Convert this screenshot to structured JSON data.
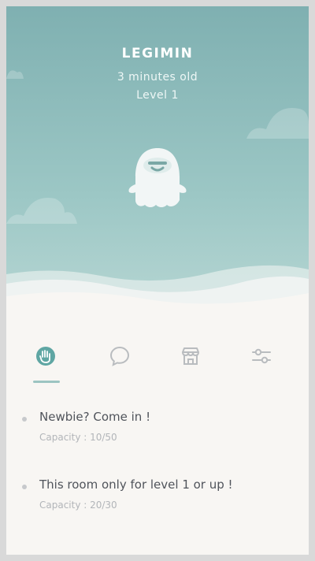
{
  "pet": {
    "name": "LEGIMIN",
    "age": "3 minutes old",
    "level": "Level 1"
  },
  "colors": {
    "sky_top": "#7fb0b1",
    "sky_bottom": "#b8d7d4",
    "accent": "#5fa6a3",
    "muted_icon": "#b9bcbf",
    "background": "#f8f6f3"
  },
  "tabs": [
    {
      "icon": "hand-icon",
      "active": true
    },
    {
      "icon": "chat-bubble-icon",
      "active": false
    },
    {
      "icon": "shop-icon",
      "active": false
    },
    {
      "icon": "sliders-icon",
      "active": false
    }
  ],
  "rooms": [
    {
      "name": "Newbie? Come in !",
      "capacity": "Capacity : 10/50"
    },
    {
      "name": "This room only for level 1 or up !",
      "capacity": "Capacity  :  20/30"
    }
  ]
}
